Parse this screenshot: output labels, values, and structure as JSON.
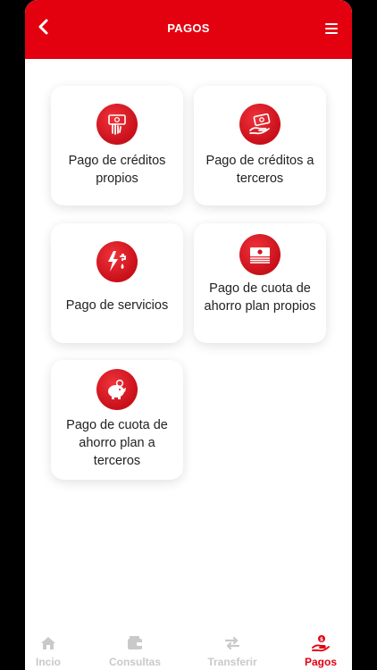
{
  "header": {
    "title": "PAGOS",
    "back_icon": "chevron-left-icon",
    "menu_icon": "hamburger-menu-icon",
    "color": "#e3000f"
  },
  "cards": [
    {
      "label": "Pago de créditos propios",
      "icon": "hand-bill-icon"
    },
    {
      "label": "Pago de créditos a terceros",
      "icon": "hand-money-icon"
    },
    {
      "label": "Pago de servicios",
      "icon": "bolt-water-icon"
    },
    {
      "label": "Pago de cuota de ahorro plan propios",
      "icon": "money-stack-icon"
    },
    {
      "label": "Pago de cuota de ahorro plan a terceros",
      "icon": "piggy-bank-icon"
    }
  ],
  "nav": [
    {
      "label": "Incio",
      "icon": "home-icon",
      "active": false
    },
    {
      "label": "Consultas",
      "icon": "wallet-icon",
      "active": false
    },
    {
      "label": "Transferir",
      "icon": "transfer-arrows-icon",
      "active": false
    },
    {
      "label": "Pagos",
      "icon": "pay-hand-icon",
      "active": true
    }
  ],
  "colors": {
    "accent": "#e3000f",
    "inactive": "#c9c9c9"
  }
}
